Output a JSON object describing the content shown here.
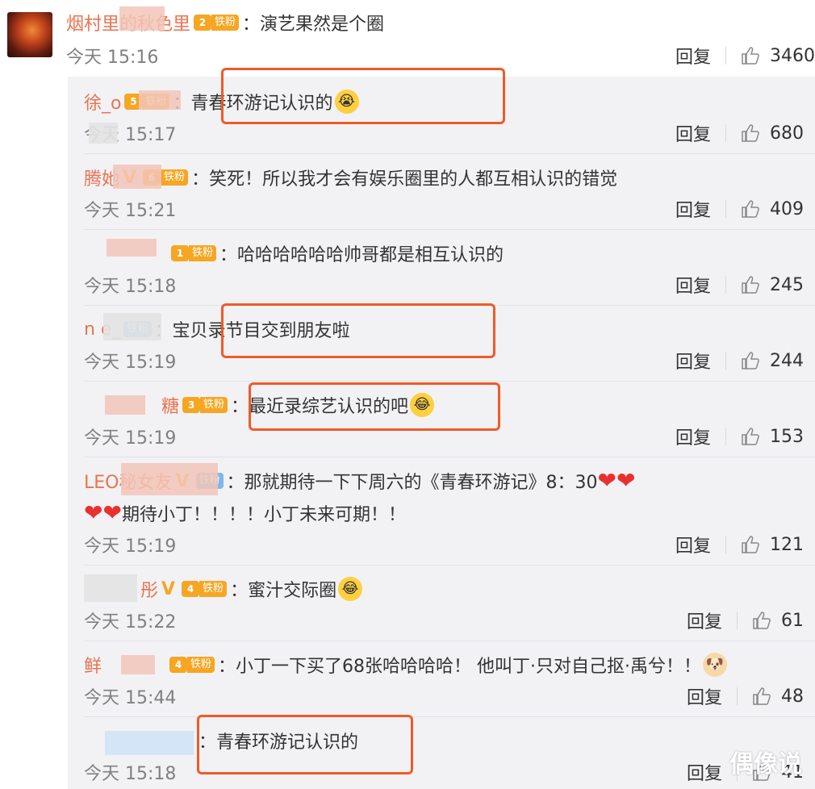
{
  "main_comment": {
    "username": "烟村里的秋色里",
    "fan_level": "2",
    "fan_label": "铁粉",
    "text": "：演艺果然是个圈",
    "time": "今天 15:16",
    "reply": "回复",
    "likes": "3460"
  },
  "replies": [
    {
      "username": "徐_o",
      "fan_level": "5",
      "fan_label": "铁粉",
      "text": "：青春环游记认识的",
      "emoji": "😭",
      "time": "今天 15:17",
      "reply": "回复",
      "likes": "680"
    },
    {
      "username": "腾她",
      "verified": "V",
      "fan_level": "6",
      "fan_label": "铁粉",
      "text": "：笑死！所以我才会有娱乐圈里的人都互相认识的错觉",
      "time": "今天 15:21",
      "reply": "回复",
      "likes": "409"
    },
    {
      "username": "",
      "fan_level": "1",
      "fan_label": "铁粉",
      "text": "：哈哈哈哈哈哈帅哥都是相互认识的",
      "time": "今天 15:18",
      "reply": "回复",
      "likes": "245"
    },
    {
      "username": "n e_",
      "fan_label": "铁粉",
      "text": "：宝贝录节目交到朋友啦",
      "time": "今天 15:19",
      "reply": "回复",
      "likes": "244"
    },
    {
      "username": "糖",
      "fan_level": "3",
      "fan_label": "铁粉",
      "text": "：最近录综艺认识的吧",
      "emoji": "😂",
      "time": "今天 15:19",
      "reply": "回复",
      "likes": "153"
    },
    {
      "username": "LEO秘女友",
      "verified": "V",
      "fan_label": "铁粉",
      "text": "：那就期待一下下周六的《青春环游记》8：30",
      "text2": "期待小丁！！！！小丁未来可期！！",
      "time": "今天 15:19",
      "reply": "回复",
      "likes": "121"
    },
    {
      "username": "彤",
      "verified": "V",
      "fan_level": "4",
      "fan_label": "铁粉",
      "text": "：蜜汁交际圈",
      "emoji": "😂",
      "time": "今天 15:22",
      "reply": "回复",
      "likes": "61"
    },
    {
      "username": "鲜",
      "fan_level": "4",
      "fan_label": "铁粉",
      "text": "：小丁一下买了68张哈哈哈哈！ 他叫丁·只对自己抠·禹兮！！",
      "emoji": "🐶",
      "time": "今天 15:44",
      "reply": "回复",
      "likes": "48"
    },
    {
      "username": "",
      "text": "：青春环游记认识的",
      "time": "今天 15:18",
      "reply": "回复",
      "likes": "41"
    }
  ],
  "watermark": "偶像说",
  "colors": {
    "username": "#eb7350",
    "highlight": "#f05a28",
    "fan_badge": "#f6a623",
    "sub_bg": "#f2f2f5"
  }
}
